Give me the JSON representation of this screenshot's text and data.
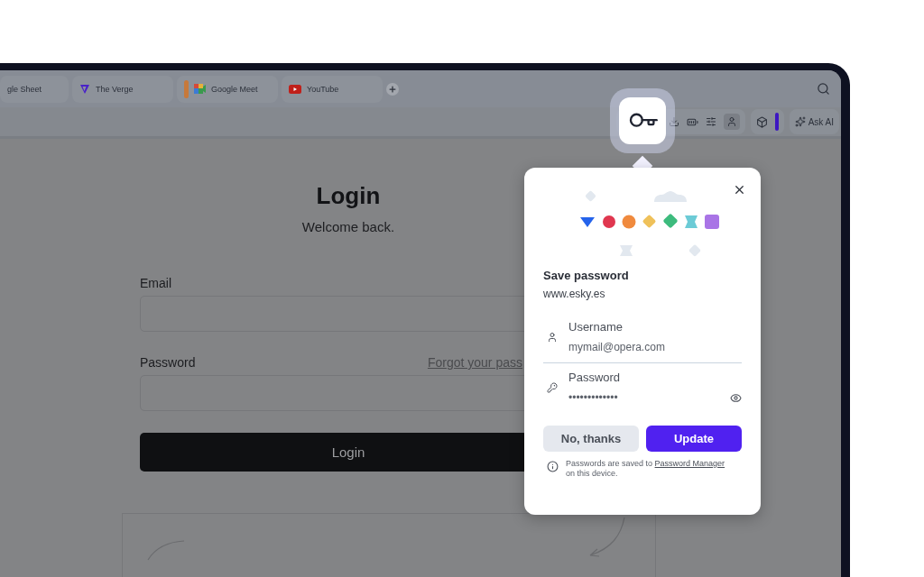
{
  "tabs": [
    {
      "title": "gle Sheet"
    },
    {
      "title": "The Verge"
    },
    {
      "title": "Google Meet",
      "color": "#c7793b"
    },
    {
      "title": "YouTube"
    }
  ],
  "toolbar": {
    "ask_ai": "Ask AI"
  },
  "login": {
    "title": "Login",
    "subtitle": "Welcome back.",
    "email_label": "Email",
    "password_label": "Password",
    "forgot_link": "Forgot your pass",
    "button": "Login"
  },
  "popup": {
    "title": "Save password",
    "site": "www.esky.es",
    "fields": [
      {
        "kind": "username",
        "label": "Username",
        "value": "mymail@opera.com"
      },
      {
        "kind": "password",
        "label": "Password",
        "value": "•••••••••••••"
      }
    ],
    "buttons": [
      {
        "kind": "secondary",
        "label": "No, thanks"
      },
      {
        "kind": "primary",
        "label": "Update"
      }
    ],
    "note_before": "Passwords are saved to",
    "note_link": "Password Manager",
    "note_after": "on this device."
  }
}
